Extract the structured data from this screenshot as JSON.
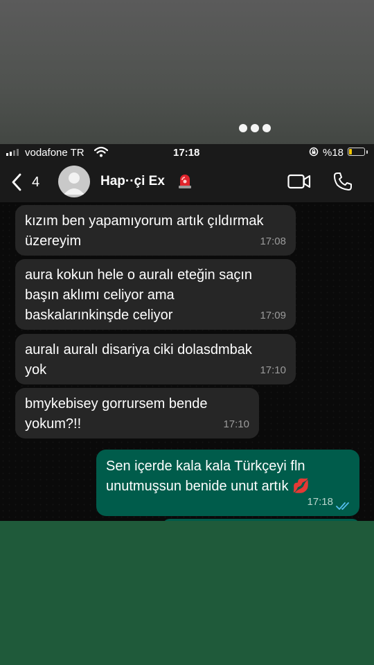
{
  "status_bar": {
    "carrier": "vodafone TR",
    "time": "17:18",
    "battery_percent": "%18",
    "battery_level": 0.18
  },
  "header": {
    "back_count": "4",
    "contact_name": "Hap··çi Ex",
    "icons": [
      "back-chevron-icon",
      "avatar-icon",
      "siren-emoji-icon",
      "video-call-icon",
      "phone-call-icon"
    ]
  },
  "messages": [
    {
      "direction": "incoming",
      "text": "kızım ben yapamıyorum artık çıldırmak\nüzereyim",
      "time": "17:08"
    },
    {
      "direction": "incoming",
      "text": "aura kokun hele o auralı eteğin saçın\nbaşın aklımı celiyor ama\nbaskalarınkinşde celiyor",
      "time": "17:09"
    },
    {
      "direction": "incoming",
      "text": "auralı auralı disariya ciki dolasdmbak\nyok",
      "time": "17:10"
    },
    {
      "direction": "incoming",
      "text": "bmykebisey gorrursem bende\nyokum?!!",
      "time": "17:10"
    },
    {
      "direction": "outgoing",
      "text": "Sen içerde kala kala Türkçeyi fln\nunutmuşsun benide unut artık 💋",
      "time": "17:18",
      "read": true
    }
  ],
  "colors": {
    "incoming_bubble": "#262626",
    "outgoing_bubble": "#005c4b",
    "read_ticks": "#53bdeb",
    "background_bottom": "#1f5a3a"
  }
}
